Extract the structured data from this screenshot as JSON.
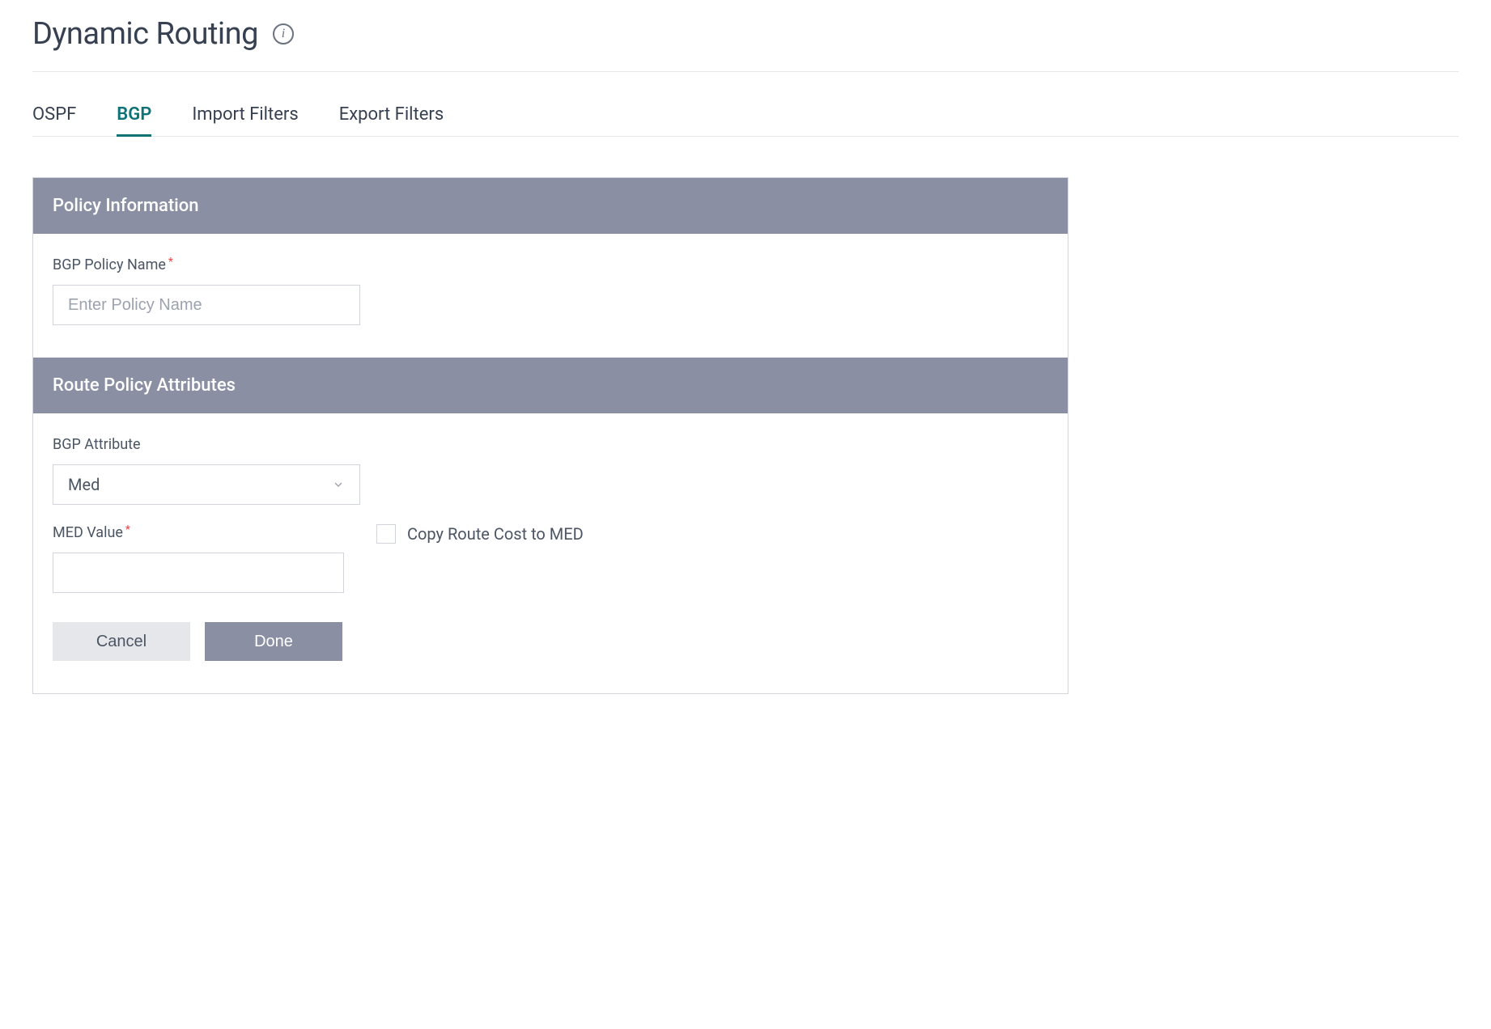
{
  "header": {
    "title": "Dynamic Routing"
  },
  "tabs": {
    "items": [
      {
        "label": "OSPF",
        "active": false
      },
      {
        "label": "BGP",
        "active": true
      },
      {
        "label": "Import Filters",
        "active": false
      },
      {
        "label": "Export Filters",
        "active": false
      }
    ]
  },
  "sections": {
    "policy_info": {
      "title": "Policy Information",
      "fields": {
        "policy_name": {
          "label": "BGP Policy Name",
          "placeholder": "Enter Policy Name",
          "value": ""
        }
      }
    },
    "route_attributes": {
      "title": "Route Policy Attributes",
      "fields": {
        "bgp_attribute": {
          "label": "BGP Attribute",
          "selected": "Med"
        },
        "med_value": {
          "label": "MED Value",
          "value": ""
        },
        "copy_route_cost": {
          "label": "Copy Route Cost to MED",
          "checked": false
        }
      }
    }
  },
  "buttons": {
    "cancel": "Cancel",
    "done": "Done"
  }
}
